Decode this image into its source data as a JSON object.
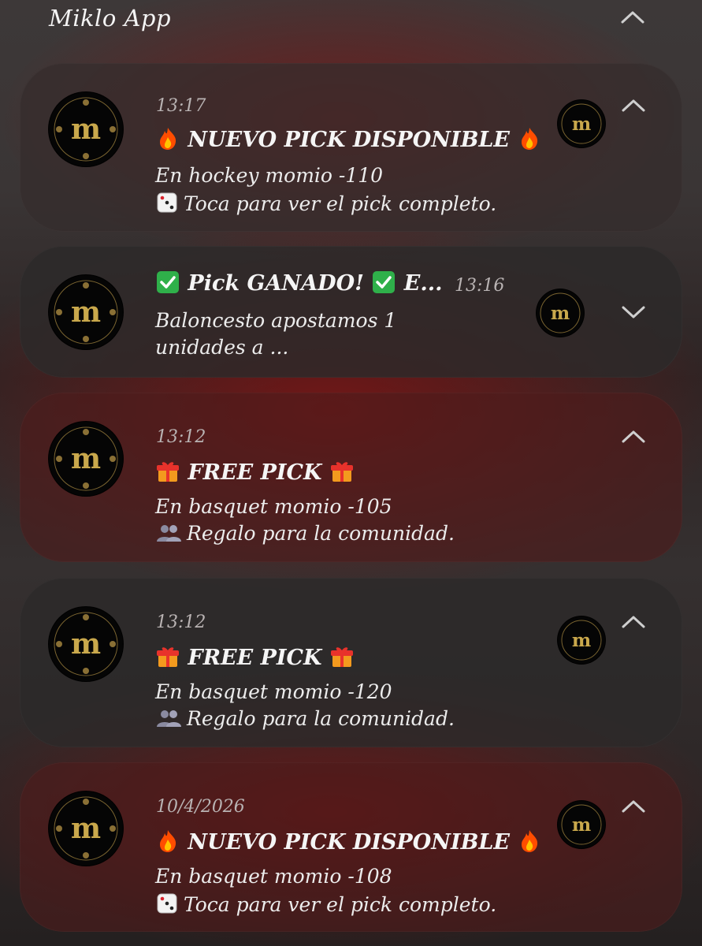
{
  "app": {
    "name": "Miklo App"
  },
  "notifications": [
    {
      "time": "13:17",
      "title": "NUEVO PICK DISPONIBLE",
      "title_emoji": "fire",
      "line1": "En hockey momio -110",
      "line2": "Toca para ver el pick completo.",
      "line2_icon": "dice"
    },
    {
      "time": "13:16",
      "title": "Pick GANADO!",
      "title_suffix": "E...",
      "title_emoji": "check",
      "line1": "Baloncesto apostamos 1",
      "line2": "unidades a  ..."
    },
    {
      "time": "13:12",
      "title": "FREE PICK",
      "title_emoji": "gift",
      "line1": "En basquet momio -105",
      "line2": "Regalo para la comunidad.",
      "line2_icon": "people"
    },
    {
      "time": "13:12",
      "title": "FREE PICK",
      "title_emoji": "gift",
      "line1": "En basquet momio -120",
      "line2": "Regalo para la comunidad.",
      "line2_icon": "people"
    },
    {
      "time": "10/4/2026",
      "title": "NUEVO PICK DISPONIBLE",
      "title_emoji": "fire",
      "line1": "En basquet momio -108",
      "line2": "Toca para ver el pick completo.",
      "line2_icon": "dice"
    }
  ],
  "colors": {
    "accent_gold": "#c9a84c",
    "check_green": "#2fb04a",
    "fire_orange": "#ff6a00"
  }
}
